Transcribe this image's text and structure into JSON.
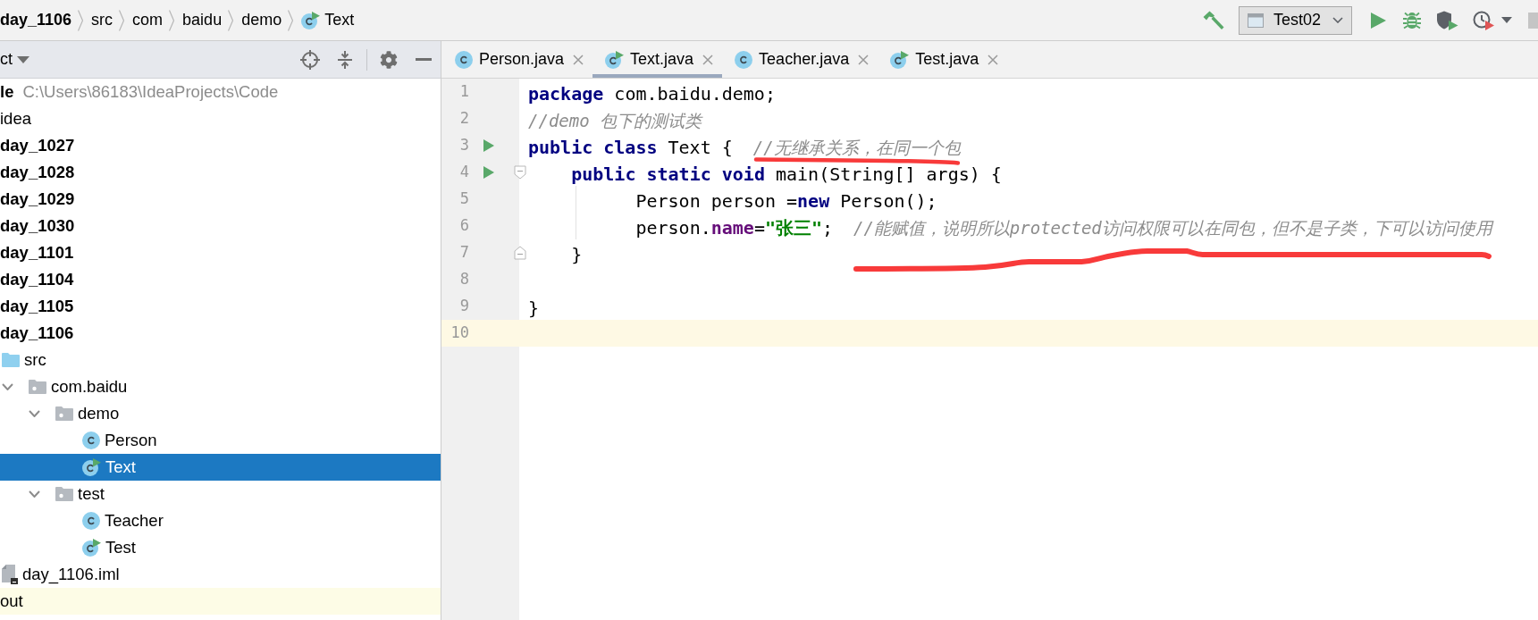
{
  "breadcrumb": [
    {
      "kind": "module",
      "label": "day_1106"
    },
    {
      "kind": "folder",
      "label": "src"
    },
    {
      "kind": "package",
      "label": "com"
    },
    {
      "kind": "package",
      "label": "baidu"
    },
    {
      "kind": "package",
      "label": "demo"
    },
    {
      "kind": "runnable_class",
      "label": "Text"
    }
  ],
  "toolbar": {
    "run_configuration": "Test02"
  },
  "project_panel": {
    "title": "ct",
    "tree": [
      {
        "kind": "project",
        "label": "le",
        "path": "C:\\Users\\86183\\IdeaProjects\\Code",
        "selected": false,
        "children": [
          {
            "kind": "folder",
            "label": "idea",
            "selected": false
          },
          {
            "kind": "module",
            "label": "day_1027",
            "selected": false
          },
          {
            "kind": "module",
            "label": "day_1028",
            "selected": false
          },
          {
            "kind": "module",
            "label": "day_1029",
            "selected": false
          },
          {
            "kind": "module",
            "label": "day_1030",
            "selected": false
          },
          {
            "kind": "module",
            "label": "day_1101",
            "selected": false
          },
          {
            "kind": "module",
            "label": "day_1104",
            "selected": false
          },
          {
            "kind": "module",
            "label": "day_1105",
            "selected": false
          },
          {
            "kind": "module",
            "label": "day_1106",
            "selected": false,
            "children": [
              {
                "kind": "source_folder",
                "label": "src",
                "selected": false,
                "children": [
                  {
                    "kind": "package",
                    "label": "com.baidu",
                    "selected": false,
                    "expanded": true,
                    "children": [
                      {
                        "kind": "package",
                        "label": "demo",
                        "selected": false,
                        "expanded": true,
                        "children": [
                          {
                            "kind": "class",
                            "label": "Person",
                            "selected": false
                          },
                          {
                            "kind": "runnable_class",
                            "label": "Text",
                            "selected": true
                          }
                        ]
                      },
                      {
                        "kind": "package",
                        "label": "test",
                        "selected": false,
                        "expanded": true,
                        "children": [
                          {
                            "kind": "class",
                            "label": "Teacher",
                            "selected": false
                          },
                          {
                            "kind": "runnable_class",
                            "label": "Test",
                            "selected": false
                          }
                        ]
                      }
                    ]
                  }
                ]
              },
              {
                "kind": "module_file",
                "label": "day_1106.iml",
                "selected": false
              }
            ]
          },
          {
            "kind": "excluded_folder",
            "label": "out",
            "selected": false
          }
        ]
      }
    ]
  },
  "editor": {
    "tabs": [
      {
        "kind": "class",
        "label": "Person.java",
        "selected": false
      },
      {
        "kind": "runnable_class",
        "label": "Text.java",
        "selected": true
      },
      {
        "kind": "class",
        "label": "Teacher.java",
        "selected": false
      },
      {
        "kind": "runnable_class",
        "label": "Test.java",
        "selected": false
      }
    ],
    "lines": [
      {
        "number": "1",
        "runnable": false,
        "current": false,
        "tokens": [
          {
            "kind": "keyword",
            "text": "package"
          },
          {
            "kind": "plain",
            "text": " com.baidu.demo;"
          }
        ]
      },
      {
        "number": "2",
        "runnable": false,
        "current": false,
        "comment": "//demo 包下的测试类"
      },
      {
        "number": "3",
        "runnable": true,
        "current": false,
        "tokens": [
          {
            "kind": "keyword",
            "text": "public"
          },
          {
            "kind": "keyword",
            "text": " class"
          },
          {
            "kind": "plain",
            "text": " Text {"
          }
        ],
        "comment": "  //无继承关系，在同一个包",
        "underline": {
          "kind": "flat"
        }
      },
      {
        "number": "4",
        "runnable": true,
        "current": false,
        "fold": {
          "kind": "start"
        },
        "tokens": [
          {
            "kind": "keyword",
            "text": "    public"
          },
          {
            "kind": "keyword",
            "text": " static"
          },
          {
            "kind": "keyword",
            "text": " void"
          },
          {
            "kind": "plain",
            "text": " main(String[] args) {"
          }
        ]
      },
      {
        "number": "5",
        "runnable": false,
        "current": false,
        "tokens": [
          {
            "kind": "plain",
            "text": "          Person person ="
          },
          {
            "kind": "keyword",
            "text": "new"
          },
          {
            "kind": "plain",
            "text": " Person();"
          }
        ]
      },
      {
        "number": "6",
        "runnable": false,
        "current": false,
        "tokens": [
          {
            "kind": "plain",
            "text": "          person."
          },
          {
            "kind": "field",
            "text": "name"
          },
          {
            "kind": "plain",
            "text": "="
          },
          {
            "kind": "string",
            "text": "\"张三\""
          },
          {
            "kind": "plain",
            "text": ";"
          }
        ],
        "comment": "  //能赋值，说明所以protected访问权限可以在同包，但不是子类，下可以访问使用",
        "underline": {
          "kind": "rising"
        }
      },
      {
        "number": "7",
        "runnable": false,
        "current": false,
        "fold": {
          "kind": "end"
        },
        "tokens": [
          {
            "kind": "plain",
            "text": "    }"
          }
        ]
      },
      {
        "number": "8",
        "runnable": false,
        "current": false
      },
      {
        "number": "9",
        "runnable": false,
        "current": false,
        "tokens": [
          {
            "kind": "plain",
            "text": "}"
          }
        ]
      },
      {
        "number": "10",
        "runnable": false,
        "current": true
      }
    ]
  }
}
